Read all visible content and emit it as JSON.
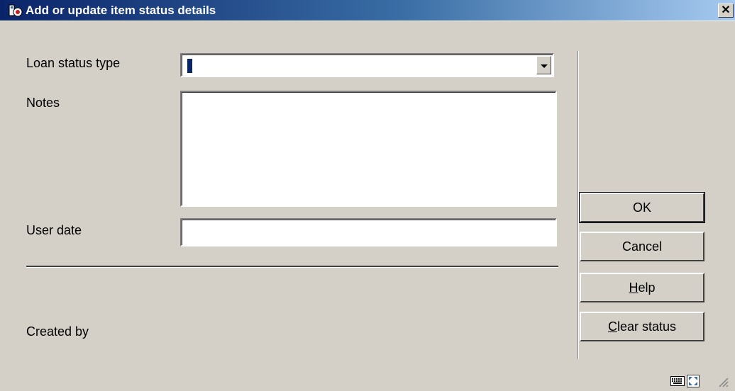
{
  "window": {
    "title": "Add or update item status details",
    "close_glyph": "✕",
    "icon": "library-app-icon"
  },
  "form": {
    "loan_status_type": {
      "label": "Loan status type",
      "value": ""
    },
    "notes": {
      "label": "Notes",
      "value": ""
    },
    "user_date": {
      "label": "User date",
      "value": ""
    },
    "created_by": {
      "label": "Created  by",
      "value": ""
    }
  },
  "buttons": {
    "ok": {
      "label": "OK"
    },
    "cancel": {
      "label": "Cancel"
    },
    "help": {
      "mnemonic": "H",
      "rest": "elp"
    },
    "clear_status": {
      "mnemonic": "C",
      "rest": "lear status"
    }
  },
  "status_bar": {
    "icons": [
      "keyboard-icon",
      "resize-window-icon",
      "size-grip-icon"
    ]
  }
}
